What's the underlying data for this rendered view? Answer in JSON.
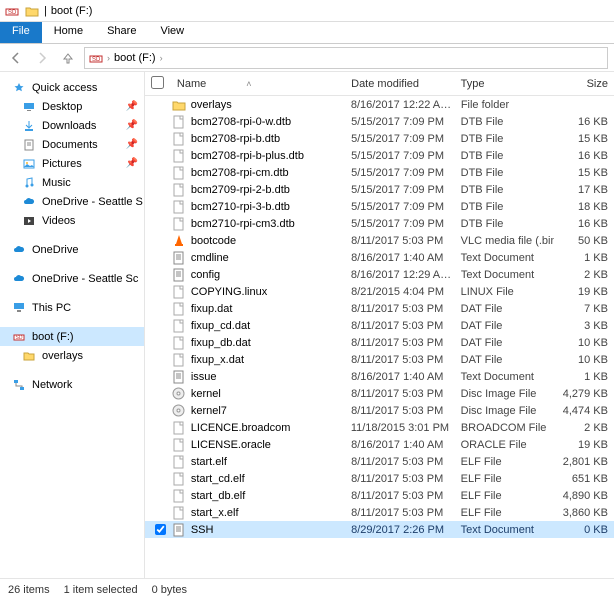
{
  "window": {
    "title": "boot (F:)",
    "sep": "|"
  },
  "ribbon": {
    "file": "File",
    "home": "Home",
    "share": "Share",
    "view": "View"
  },
  "address": {
    "crumb": "boot (F:)"
  },
  "sidebar": {
    "quick": "Quick access",
    "desktop": "Desktop",
    "downloads": "Downloads",
    "documents": "Documents",
    "pictures": "Pictures",
    "music": "Music",
    "od_seattle1": "OneDrive - Seattle S",
    "videos": "Videos",
    "onedrive": "OneDrive",
    "od_seattle2": "OneDrive - Seattle Sc",
    "thispc": "This PC",
    "boot": "boot (F:)",
    "overlays": "overlays",
    "network": "Network"
  },
  "columns": {
    "name": "Name",
    "date": "Date modified",
    "type": "Type",
    "size": "Size"
  },
  "files": [
    {
      "n": "overlays",
      "d": "8/16/2017 12:22 A…",
      "t": "File folder",
      "s": "",
      "i": "folder"
    },
    {
      "n": "bcm2708-rpi-0-w.dtb",
      "d": "5/15/2017 7:09 PM",
      "t": "DTB File",
      "s": "16 KB",
      "i": "file"
    },
    {
      "n": "bcm2708-rpi-b.dtb",
      "d": "5/15/2017 7:09 PM",
      "t": "DTB File",
      "s": "15 KB",
      "i": "file"
    },
    {
      "n": "bcm2708-rpi-b-plus.dtb",
      "d": "5/15/2017 7:09 PM",
      "t": "DTB File",
      "s": "16 KB",
      "i": "file"
    },
    {
      "n": "bcm2708-rpi-cm.dtb",
      "d": "5/15/2017 7:09 PM",
      "t": "DTB File",
      "s": "15 KB",
      "i": "file"
    },
    {
      "n": "bcm2709-rpi-2-b.dtb",
      "d": "5/15/2017 7:09 PM",
      "t": "DTB File",
      "s": "17 KB",
      "i": "file"
    },
    {
      "n": "bcm2710-rpi-3-b.dtb",
      "d": "5/15/2017 7:09 PM",
      "t": "DTB File",
      "s": "18 KB",
      "i": "file"
    },
    {
      "n": "bcm2710-rpi-cm3.dtb",
      "d": "5/15/2017 7:09 PM",
      "t": "DTB File",
      "s": "16 KB",
      "i": "file"
    },
    {
      "n": "bootcode",
      "d": "8/11/2017 5:03 PM",
      "t": "VLC media file (.bin)",
      "s": "50 KB",
      "i": "vlc"
    },
    {
      "n": "cmdline",
      "d": "8/16/2017 1:40 AM",
      "t": "Text Document",
      "s": "1 KB",
      "i": "txt"
    },
    {
      "n": "config",
      "d": "8/16/2017 12:29 A…",
      "t": "Text Document",
      "s": "2 KB",
      "i": "txt"
    },
    {
      "n": "COPYING.linux",
      "d": "8/21/2015 4:04 PM",
      "t": "LINUX File",
      "s": "19 KB",
      "i": "file"
    },
    {
      "n": "fixup.dat",
      "d": "8/11/2017 5:03 PM",
      "t": "DAT File",
      "s": "7 KB",
      "i": "file"
    },
    {
      "n": "fixup_cd.dat",
      "d": "8/11/2017 5:03 PM",
      "t": "DAT File",
      "s": "3 KB",
      "i": "file"
    },
    {
      "n": "fixup_db.dat",
      "d": "8/11/2017 5:03 PM",
      "t": "DAT File",
      "s": "10 KB",
      "i": "file"
    },
    {
      "n": "fixup_x.dat",
      "d": "8/11/2017 5:03 PM",
      "t": "DAT File",
      "s": "10 KB",
      "i": "file"
    },
    {
      "n": "issue",
      "d": "8/16/2017 1:40 AM",
      "t": "Text Document",
      "s": "1 KB",
      "i": "txt"
    },
    {
      "n": "kernel",
      "d": "8/11/2017 5:03 PM",
      "t": "Disc Image File",
      "s": "4,279 KB",
      "i": "disc"
    },
    {
      "n": "kernel7",
      "d": "8/11/2017 5:03 PM",
      "t": "Disc Image File",
      "s": "4,474 KB",
      "i": "disc"
    },
    {
      "n": "LICENCE.broadcom",
      "d": "11/18/2015 3:01 PM",
      "t": "BROADCOM File",
      "s": "2 KB",
      "i": "file"
    },
    {
      "n": "LICENSE.oracle",
      "d": "8/16/2017 1:40 AM",
      "t": "ORACLE File",
      "s": "19 KB",
      "i": "file"
    },
    {
      "n": "start.elf",
      "d": "8/11/2017 5:03 PM",
      "t": "ELF File",
      "s": "2,801 KB",
      "i": "file"
    },
    {
      "n": "start_cd.elf",
      "d": "8/11/2017 5:03 PM",
      "t": "ELF File",
      "s": "651 KB",
      "i": "file"
    },
    {
      "n": "start_db.elf",
      "d": "8/11/2017 5:03 PM",
      "t": "ELF File",
      "s": "4,890 KB",
      "i": "file"
    },
    {
      "n": "start_x.elf",
      "d": "8/11/2017 5:03 PM",
      "t": "ELF File",
      "s": "3,860 KB",
      "i": "file"
    },
    {
      "n": "SSH",
      "d": "8/29/2017 2:26 PM",
      "t": "Text Document",
      "s": "0 KB",
      "i": "txt",
      "sel": true
    }
  ],
  "status": {
    "items": "26 items",
    "selected": "1 item selected",
    "bytes": "0 bytes"
  }
}
